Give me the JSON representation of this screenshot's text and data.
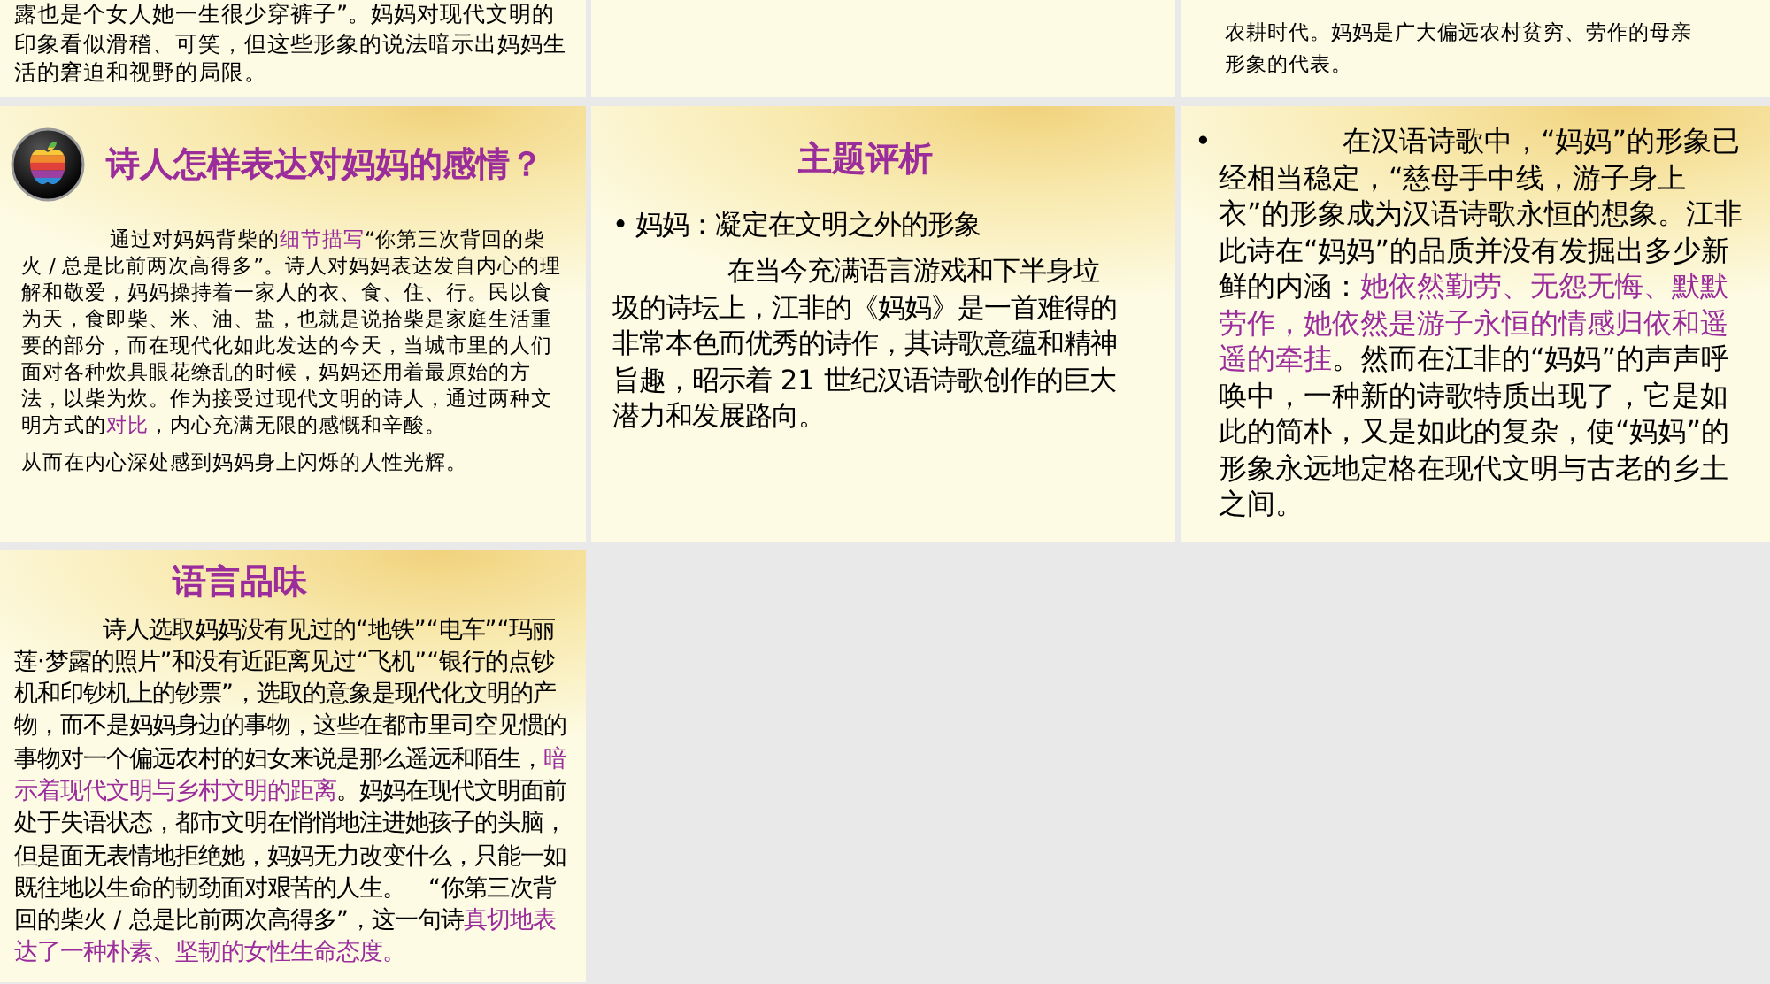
{
  "slides": [
    {
      "kind": "continuation",
      "paragraphs": [
        {
          "indent": false,
          "segments": [
            {
              "text": "露也是个女人她一生很少穿裤子”。妈妈对现代文明的印象看似滑稽、可笑，但这些形象的说法暗示出妈妈生活的窘迫和视野的局限。",
              "highlight": false
            }
          ]
        }
      ]
    },
    {
      "kind": "continuation"
    },
    {
      "kind": "continuation",
      "paragraphs": [
        {
          "indent": false,
          "segments": [
            {
              "text": "农耕时代。妈妈是广大偏远农村贫穷、劳作的母亲形象的代表。",
              "highlight": false
            }
          ]
        }
      ]
    },
    {
      "kind": "titled-icon",
      "title": "诗人怎样表达对妈妈的感情？",
      "paragraphs": [
        {
          "indent": true,
          "segments": [
            {
              "text": "通过对妈妈背柴的",
              "highlight": false
            },
            {
              "text": "细节描写",
              "highlight": true
            },
            {
              "text": "“你第三次背回的柴火 / 总是比前两次高得多”。诗人对妈妈表达发自内心的理解和敬爱，妈妈操持着一家人的衣、食、住、行。民以食为天，食即柴、米、油、盐，也就是说拾柴是家庭生活重要的部分，而在现代化如此发达的今天，当城市里的人们面对各种炊具眼花缭乱的时候，妈妈还用着最原始的方法，以柴为炊。作为接受过现代文明的诗人，通过两种文明方式的",
              "highlight": false
            },
            {
              "text": "对比",
              "highlight": true
            },
            {
              "text": "，内心充满无限的感慨和辛酸。",
              "highlight": false
            }
          ]
        },
        {
          "indent": false,
          "segments": [
            {
              "text": "从而在内心深处感到妈妈身上闪烁的人性光辉。",
              "highlight": false
            }
          ]
        }
      ]
    },
    {
      "kind": "titled",
      "title": "主题评析",
      "paragraphs": [
        {
          "marker": "•",
          "indent": false,
          "segments": [
            {
              "text": "妈妈：凝定在文明之外的形象",
              "highlight": false
            }
          ]
        },
        {
          "indent": true,
          "segments": [
            {
              "text": "在当今充满语言游戏和下半身垃圾的诗坛上，江非的《妈妈》是一首难得的非常本色而优秀的诗作，其诗歌意蕴和精神旨趣，昭示着 21 世纪汉语诗歌创作的巨大潜力和发展路向。",
              "highlight": false
            }
          ]
        }
      ]
    },
    {
      "kind": "bullets",
      "paragraphs": [
        {
          "marker": "•",
          "indent": true,
          "segments": [
            {
              "text": "在汉语诗歌中，“妈妈”的形象已经相当稳定，“慈母手中线，游子身上衣”的形象成为汉语诗歌永恒的想象。江非此诗在“妈妈”的品质并没有发掘出多少新鲜的内涵：",
              "highlight": false
            },
            {
              "text": "她依然勤劳、无怨无悔、默默劳作，她依然是游子永恒的情感归依和遥遥的牵挂",
              "highlight": true
            },
            {
              "text": "。然而在江非的“妈妈”的声声呼唤中，一种新的诗歌特质出现了，它是如此的简朴，又是如此的复杂，使“妈妈”的形象永远地定格在现代文明与古老的乡土之间。",
              "highlight": false
            }
          ]
        }
      ]
    },
    {
      "kind": "titled",
      "title": "语言品味",
      "paragraphs": [
        {
          "indent": true,
          "segments": [
            {
              "text": "诗人选取妈妈没有见过的“地铁”“电车”“玛丽莲·梦露的照片”和没有近距离见过“飞机”“银行的点钞机和印钞机上的钞票”，选取的意象是现代化文明的产物，而不是妈妈身边的事物，这些在都市里司空见惯的事物对一个偏远农村的妇女来说是那么遥远和陌生，",
              "highlight": false
            },
            {
              "text": "暗示着现代文明与乡村文明的距离",
              "highlight": true
            },
            {
              "text": "。妈妈在现代文明面前处于失语状态，都市文明在悄悄地注进她孩子的头脑，但是面无表情地拒绝她，妈妈无力改变什么，只能一如既往地以生命的韧劲面对艰苦的人生。　“你第三次背回的柴火 / 总是比前两次高得多”，这一句诗",
              "highlight": false
            },
            {
              "text": "真切地表达了一种朴素、坚韧的女性生命态度。",
              "highlight": true
            }
          ]
        }
      ]
    }
  ]
}
